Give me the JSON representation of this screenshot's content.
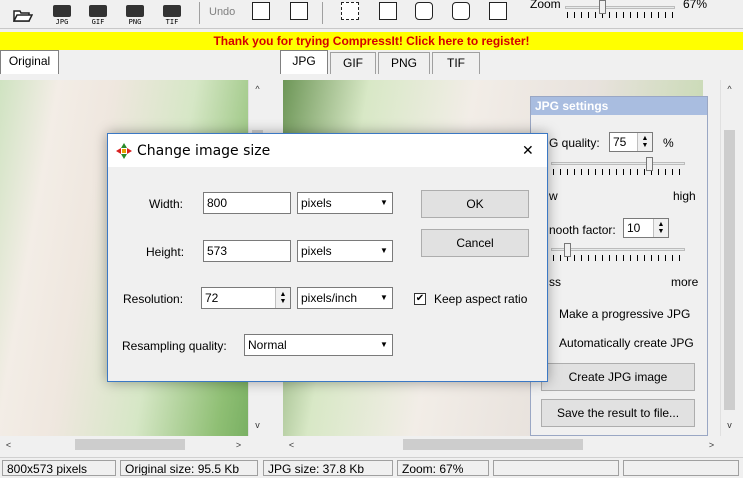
{
  "toolbar": {
    "buttons": [
      {
        "label": "",
        "icon": "open-folder-icon"
      },
      {
        "label": "JPG",
        "icon": "save-jpg-icon"
      },
      {
        "label": "GIF",
        "icon": "save-gif-icon"
      },
      {
        "label": "PNG",
        "icon": "save-png-icon"
      },
      {
        "label": "TIF",
        "icon": "save-tif-icon"
      }
    ],
    "undo_label": "Undo",
    "zoom_label": "Zoom",
    "zoom_value": "67%",
    "zoom_fraction": 0.33
  },
  "banner": {
    "text": "Thank you for trying CompressIt! Click here to register!"
  },
  "tabs": {
    "left": [
      "Original"
    ],
    "right": [
      "JPG",
      "GIF",
      "PNG",
      "TIF"
    ],
    "active_right": "JPG"
  },
  "jpg_settings": {
    "title": "JPG settings",
    "quality_label": "G quality:",
    "quality_value": "75",
    "quality_unit": "%",
    "quality_low": "w",
    "quality_high": "high",
    "quality_fraction": 0.75,
    "smooth_label": "nooth factor:",
    "smooth_value": "10",
    "smooth_low": "ss",
    "smooth_high": "more",
    "smooth_fraction": 0.1,
    "progressive_label": "Make a progressive JPG",
    "auto_label": "Automatically create JPG",
    "create_button": "Create JPG image",
    "save_button": "Save the result to file..."
  },
  "dialog": {
    "title": "Change image size",
    "close_glyph": "✕",
    "width_label": "Width:",
    "width_value": "800",
    "height_label": "Height:",
    "height_value": "573",
    "resolution_label": "Resolution:",
    "resolution_value": "72",
    "resampling_label": "Resampling quality:",
    "resampling_value": "Normal",
    "unit_width": "pixels",
    "unit_height": "pixels",
    "unit_resolution": "pixels/inch",
    "ok_button": "OK",
    "cancel_button": "Cancel",
    "keep_aspect_label": "Keep aspect ratio",
    "keep_aspect_checked": "✔"
  },
  "status": {
    "dimensions": "800x573 pixels",
    "original_size": "Original size: 95.5 Kb",
    "jpg_size": "JPG size: 37.8 Kb",
    "zoom": "Zoom: 67%"
  },
  "scroll": {
    "left_arrow": "<",
    "right_arrow": ">",
    "up_arrow": "^",
    "down_arrow": "v"
  }
}
